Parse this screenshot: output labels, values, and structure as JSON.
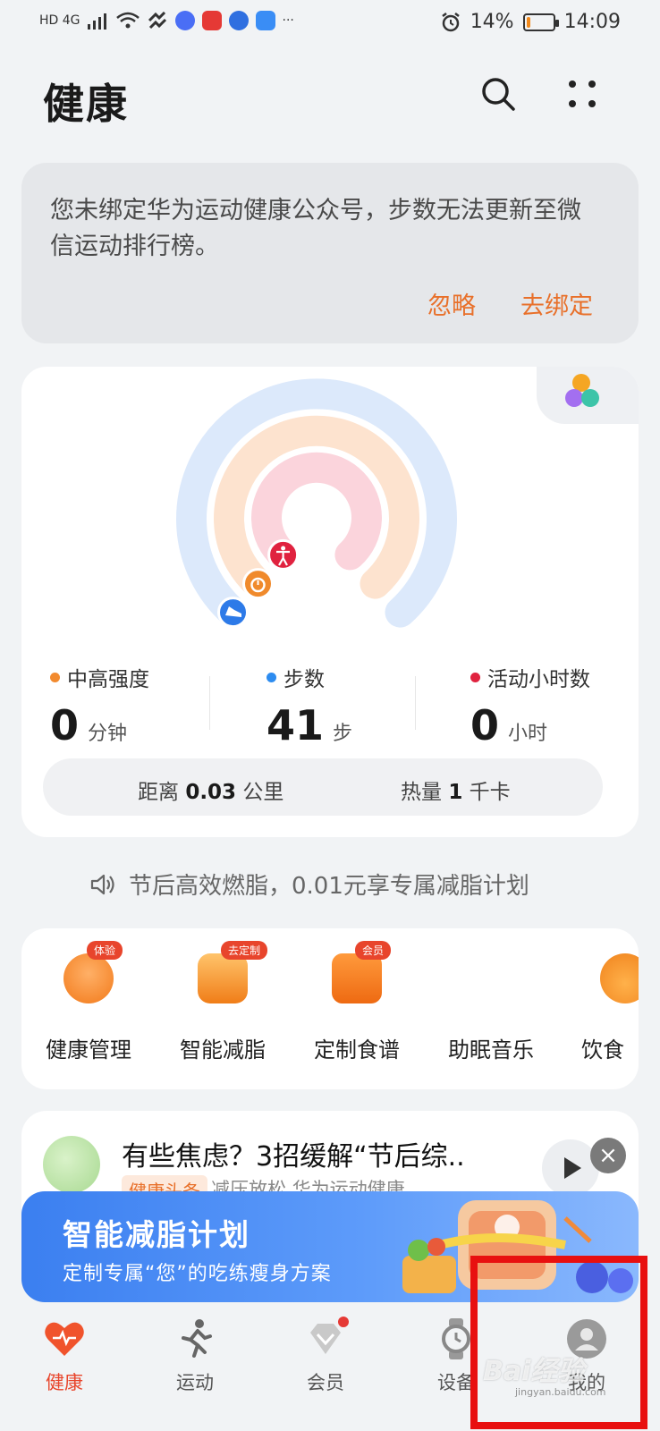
{
  "status_bar": {
    "network": "HD 4G",
    "battery_percent": "14%",
    "battery_level": 0.14,
    "time": "14:09",
    "more": "···"
  },
  "header": {
    "title": "健康",
    "search_icon": "search-icon",
    "more_icon": "more-dots-icon"
  },
  "notice": {
    "text": "您未绑定华为运动健康公众号，步数无法更新至微信运动排行榜。",
    "ignore_label": "忽略",
    "bind_label": "去绑定",
    "accent": "#e8702a"
  },
  "activity": {
    "stats": [
      {
        "label": "中高强度",
        "value": "0",
        "unit": "分钟",
        "color": "#f28a2e"
      },
      {
        "label": "步数",
        "value": "41",
        "unit": "步",
        "color": "#2d8cf0"
      },
      {
        "label": "活动小时数",
        "value": "0",
        "unit": "小时",
        "color": "#e0223f"
      }
    ],
    "distance_label": "距离",
    "distance_value": "0.03",
    "distance_unit": "公里",
    "calories_label": "热量",
    "calories_value": "1",
    "calories_unit": "千卡",
    "ring_colors": {
      "outer": "#dce9fb",
      "middle": "#fde3cf",
      "inner": "#fbd4dc"
    },
    "icons": [
      "shoe-icon",
      "stopwatch-icon",
      "activity-person-icon"
    ]
  },
  "promo": {
    "text": "节后高效燃脂，0.01元享专属减脂计划",
    "icon": "speaker-icon"
  },
  "services": [
    {
      "label": "健康管理",
      "badge": "体验"
    },
    {
      "label": "智能减脂",
      "badge": "去定制"
    },
    {
      "label": "定制食谱",
      "badge": "会员"
    },
    {
      "label": "助眠音乐",
      "badge": ""
    },
    {
      "label": "饮食",
      "badge": ""
    }
  ],
  "article": {
    "title": "有些焦虑？3招缓解“节后综..",
    "tag": "健康头条",
    "meta": "减压放松 华为运动健康"
  },
  "banner": {
    "title": "智能减脂计划",
    "subtitle": "定制专属“您”的吃练瘦身方案"
  },
  "bottom_nav": [
    {
      "label": "健康",
      "icon": "heart-icon",
      "active": true
    },
    {
      "label": "运动",
      "icon": "running-icon",
      "active": false
    },
    {
      "label": "会员",
      "icon": "diamond-icon",
      "active": false
    },
    {
      "label": "设备",
      "icon": "watch-icon",
      "active": false
    },
    {
      "label": "我的",
      "icon": "avatar-icon",
      "active": false
    }
  ],
  "watermark": {
    "text": "Bai经验",
    "url": "jingyan.baidu.com"
  }
}
